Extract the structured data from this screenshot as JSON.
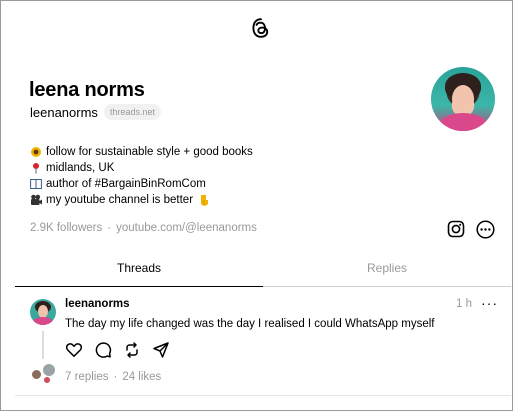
{
  "app": {
    "logo_icon": "threads-logo-icon"
  },
  "profile": {
    "name": "leena norms",
    "handle": "leenanorms",
    "domain_badge": "threads.net",
    "bio": [
      {
        "icon": "sunflower-icon",
        "text": "follow for sustainable style + good books"
      },
      {
        "icon": "round-pushpin-icon",
        "text": "midlands, UK"
      },
      {
        "icon": "open-book-icon",
        "text": "author of #BargainBinRomCom"
      },
      {
        "icon": "movie-camera-icon",
        "text": "my youtube channel is better"
      }
    ],
    "bio_trailing_icon": "backhand-index-pointing-down-icon",
    "followers": "2.9K followers",
    "separator": "·",
    "link": "youtube.com/@leenanorms"
  },
  "tabs": [
    {
      "label": "Threads",
      "active": true
    },
    {
      "label": "Replies",
      "active": false
    }
  ],
  "post": {
    "user": "leenanorms",
    "time": "1 h",
    "more": "···",
    "text": "The day my life changed was the day I realised I could WhatsApp myself",
    "replies": "7 replies",
    "separator": "·",
    "likes": "24 likes",
    "actions": [
      "heart-icon",
      "comment-icon",
      "repost-icon",
      "share-icon"
    ]
  },
  "colors": {
    "muted": "#999999",
    "text": "#000000",
    "border": "#9a9a9a"
  }
}
